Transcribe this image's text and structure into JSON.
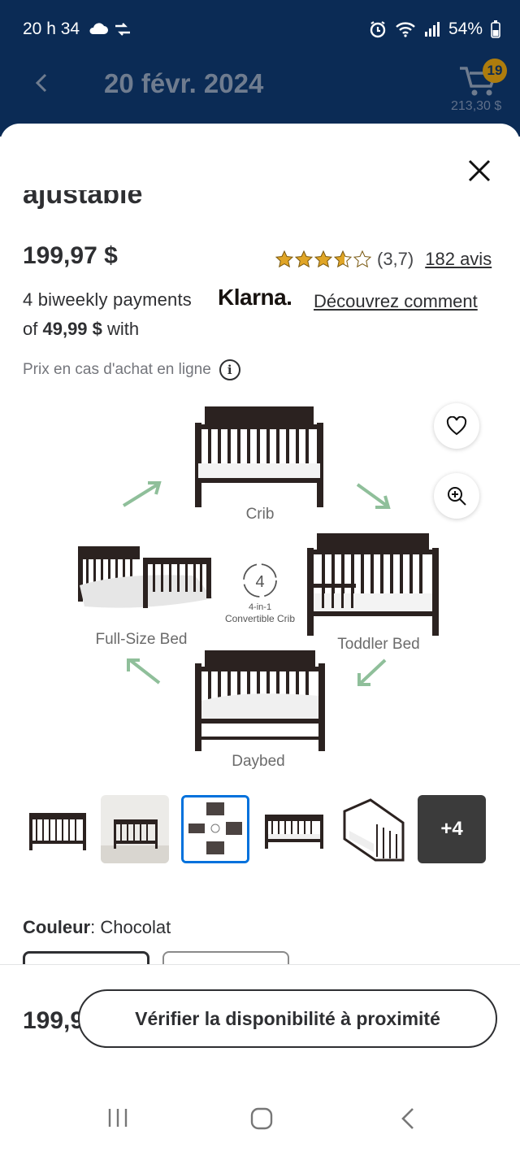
{
  "status_bar": {
    "time": "20 h 34",
    "battery": "54%"
  },
  "header": {
    "title": "20 févr. 2024",
    "cart_count": "19",
    "cart_total": "213,30 $"
  },
  "product": {
    "title_fragment": "ajustable",
    "price": "199,97 $",
    "rating_value": "(3,7)",
    "rating_stars": 3.7,
    "reviews": "182 avis",
    "payment_line1": "4 biweekly payments",
    "klarna": "Klarna.",
    "discover_link": "Découvrez comment",
    "payment_prefix": "of",
    "payment_amount": "49,99 $",
    "payment_suffix": "with",
    "online_price_note": "Prix en cas d'achat en ligne",
    "image_labels": {
      "crib": "Crib",
      "full_bed": "Full-Size Bed",
      "toddler_bed": "Toddler Bed",
      "daybed": "Daybed",
      "badge_number": "4",
      "badge_line1": "4-in-1",
      "badge_line2": "Convertible Crib"
    },
    "more_thumbs": "+4",
    "color_label": "Couleur",
    "color_value": "Chocolat"
  },
  "bottom_bar": {
    "price_partial": "199,9",
    "availability_button": "Vérifier la disponibilité à proximité"
  },
  "colors": {
    "header_bg": "#0b2b55",
    "accent_blue": "#0071dc",
    "star": "#e0a526",
    "arrow_green": "#8fbf9a"
  },
  "icons": [
    "back-arrow-icon",
    "cart-icon",
    "close-icon",
    "heart-icon",
    "zoom-icon",
    "info-icon",
    "star-icon",
    "recent-apps-icon",
    "home-icon",
    "back-nav-icon"
  ]
}
